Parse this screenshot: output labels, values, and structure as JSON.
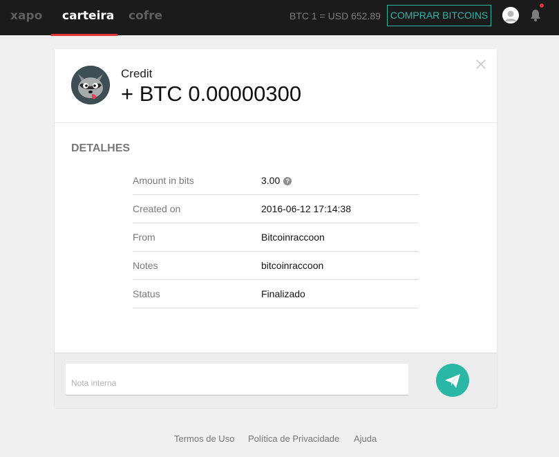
{
  "nav": {
    "items": [
      {
        "label": "xapo"
      },
      {
        "label": "carteira"
      },
      {
        "label": "cofre"
      }
    ],
    "active": "carteira",
    "rate_text": "BTC 1 = USD 652.89",
    "buy_button": "COMPRAR BITCOINS"
  },
  "transaction": {
    "type": "Credit",
    "amount": "+ BTC 0.00000300"
  },
  "details": {
    "title": "DETALHES",
    "rows": [
      {
        "label": "Amount in bits",
        "value": "3.00"
      },
      {
        "label": "Created on",
        "value": "2016-06-12 17:14:38"
      },
      {
        "label": "From",
        "value": "Bitcoinraccoon"
      },
      {
        "label": "Notes",
        "value": "bitcoinraccoon"
      },
      {
        "label": "Status",
        "value": "Finalizado"
      }
    ],
    "help_glyph": "?"
  },
  "note": {
    "placeholder": "Nota interna",
    "value": ""
  },
  "footer": {
    "links": [
      "Termos de Uso",
      "Política de Privacidade",
      "Ajuda"
    ]
  },
  "colors": {
    "accent": "#2bb7a6",
    "topbar": "#1b1b1b",
    "active_underline": "#e2343b",
    "notification": "#e2343b"
  }
}
